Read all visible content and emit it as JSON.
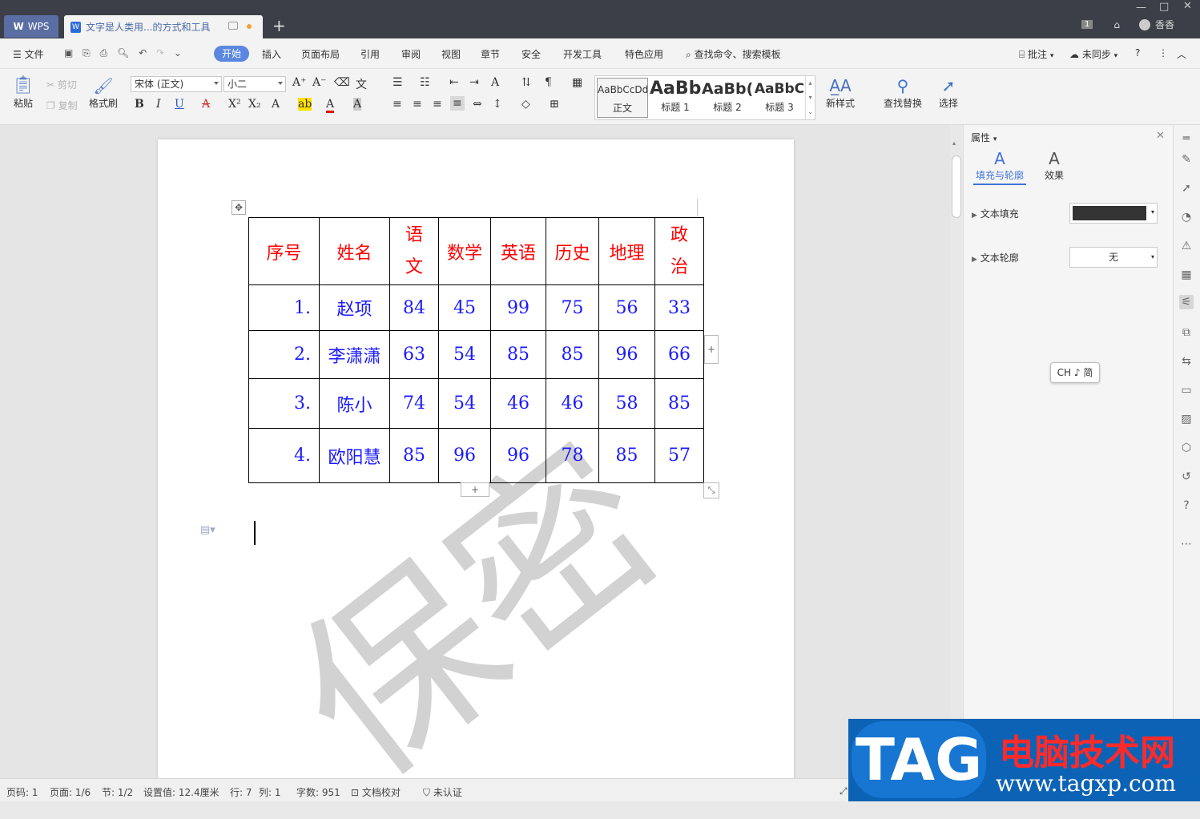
{
  "titlebar": {
    "app_tab": "WPS",
    "doc_tab": "文字是人类用...的方式和工具",
    "page_badge": "1",
    "user": "香香"
  },
  "menu": {
    "file": "文件",
    "tabs": [
      "开始",
      "插入",
      "页面布局",
      "引用",
      "审阅",
      "视图",
      "章节",
      "安全",
      "开发工具",
      "特色应用"
    ],
    "search": "查找命令、搜索模板",
    "comment": "批注",
    "sync": "未同步"
  },
  "ribbon": {
    "paste": "粘贴",
    "cut": "剪切",
    "copy": "复制",
    "format_painter": "格式刷",
    "font_name": "宋体 (正文)",
    "font_size": "小二",
    "styles": [
      {
        "preview": "AaBbCcDd",
        "name": "正文"
      },
      {
        "preview": "AaBb",
        "name": "标题 1"
      },
      {
        "preview": "AaBb(",
        "name": "标题 2"
      },
      {
        "preview": "AaBbC",
        "name": "标题 3"
      }
    ],
    "new_style": "新样式",
    "find_replace": "查找替换",
    "select": "选择"
  },
  "table": {
    "headers": [
      "序号",
      "姓名",
      "语文",
      "数学",
      "英语",
      "历史",
      "地理",
      "政治"
    ],
    "rows": [
      [
        "1.",
        "赵项",
        "84",
        "45",
        "99",
        "75",
        "56",
        "33"
      ],
      [
        "2.",
        "李潇潇",
        "63",
        "54",
        "85",
        "85",
        "96",
        "66"
      ],
      [
        "3.",
        "陈小",
        "74",
        "54",
        "46",
        "46",
        "58",
        "85"
      ],
      [
        "4.",
        "欧阳慧",
        "85",
        "96",
        "96",
        "78",
        "85",
        "57"
      ]
    ]
  },
  "watermark": "保密",
  "panel": {
    "title": "属性",
    "tab_fill": "填充与轮廓",
    "tab_effect": "效果",
    "text_fill": "文本填充",
    "text_outline": "文本轮廓",
    "outline_value": "无",
    "fill_color": "#333333"
  },
  "ime": "CH ♪ 简",
  "status": {
    "page_code": "页码: 1",
    "page": "页面: 1/6",
    "section": "节: 1/2",
    "setting": "设置值: 12.4厘米",
    "row": "行: 7",
    "col": "列: 1",
    "words": "字数: 951",
    "proof": "文档校对",
    "cert": "未认证"
  },
  "badge": {
    "tag": "TAG",
    "cn": "电脑技术网",
    "url": "www.tagxp.com"
  },
  "colors": {
    "header_text": "#ff0000",
    "cell_text": "#1a1aff",
    "accent": "#5b87e0"
  }
}
